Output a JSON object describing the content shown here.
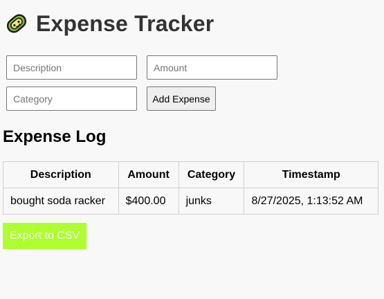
{
  "app": {
    "title": "Expense Tracker",
    "logo_icon": "pickle-logo-icon"
  },
  "form": {
    "description_placeholder": "Description",
    "amount_placeholder": "Amount",
    "category_placeholder": "Category",
    "description_value": "",
    "amount_value": "",
    "category_value": "",
    "add_label": "Add Expense"
  },
  "log": {
    "title": "Expense Log",
    "headers": [
      "Description",
      "Amount",
      "Category",
      "Timestamp"
    ],
    "rows": [
      [
        "bought soda racker",
        "$400.00",
        "junks",
        "8/27/2025, 1:13:52 AM"
      ]
    ]
  },
  "export": {
    "label": "Export to CSV",
    "color": "#adff2f"
  }
}
